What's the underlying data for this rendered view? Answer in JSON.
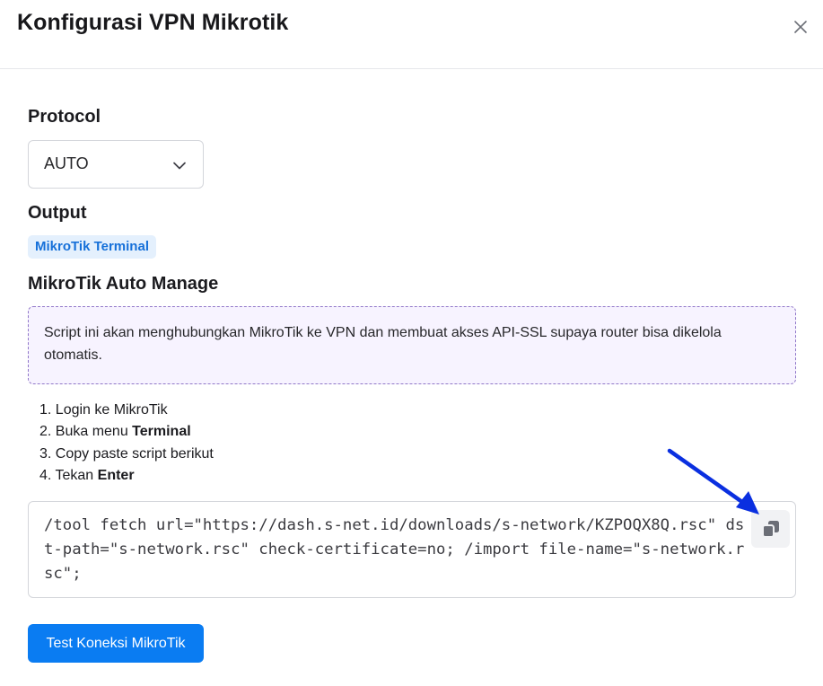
{
  "modal": {
    "title": "Konfigurasi VPN Mikrotik",
    "close_icon": "close-icon"
  },
  "protocol": {
    "label": "Protocol",
    "selected": "AUTO",
    "icon": "chevron-down-icon"
  },
  "output": {
    "label": "Output",
    "badge": "MikroTik Terminal",
    "badge_color": "#1670d9"
  },
  "auto_manage": {
    "label": "MikroTik Auto Manage",
    "info": "Script ini akan menghubungkan MikroTik ke VPN dan membuat akses API-SSL supaya router bisa dikelola otomatis."
  },
  "steps": [
    {
      "prefix": "1. Login ke MikroTik",
      "bold": ""
    },
    {
      "prefix": "2. Buka menu ",
      "bold": "Terminal"
    },
    {
      "prefix": "3. Copy paste script berikut",
      "bold": ""
    },
    {
      "prefix": "4. Tekan ",
      "bold": "Enter"
    }
  ],
  "script": {
    "code": "/tool fetch url=\"https://dash.s-net.id/downloads/s-network/KZPOQX8Q.rsc\" dst-path=\"s-network.rsc\" check-certificate=no; /import file-name=\"s-network.rsc\";",
    "copy_icon": "copy-icon",
    "annotation": "arrow-annotation",
    "annotation_color": "#0a2fe0"
  },
  "actions": {
    "test_button": "Test Koneksi MikroTik",
    "button_color": "#0a7cf2"
  }
}
